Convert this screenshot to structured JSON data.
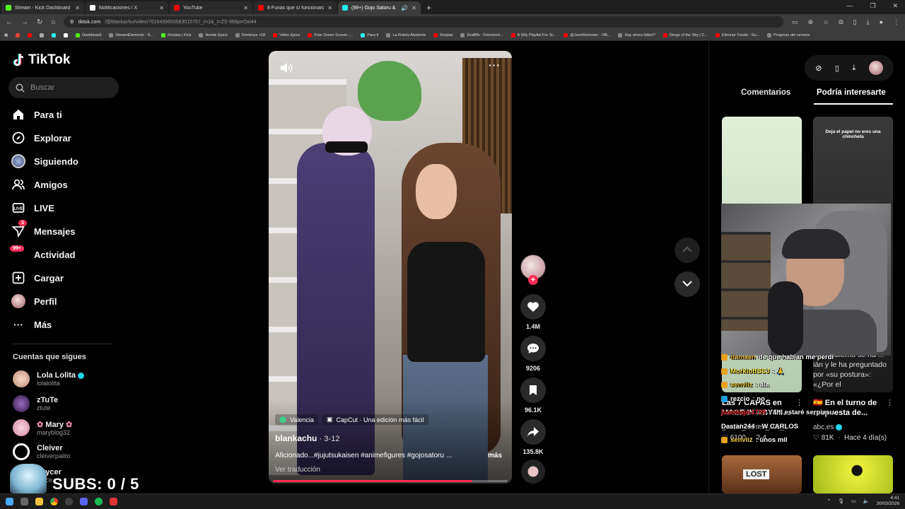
{
  "browser": {
    "tabs": [
      {
        "title": "Stream - Kick Dashboard",
        "color": "#53fc18",
        "active": false
      },
      {
        "title": "Notificaciones / X",
        "color": "#ffffff",
        "active": false
      },
      {
        "title": "YouTube",
        "color": "#ff0000",
        "active": false
      },
      {
        "title": "8 Funas que sí funcionaron y q",
        "color": "#ff0000",
        "active": false
      },
      {
        "title": "(99+) Gojo Satoru & Suku",
        "color": "#25f4ee",
        "active": true
      }
    ],
    "url_host": "tiktok.com",
    "url_path": "/@blankachu/video/7616439653583015757_r=1&_t=ZS-956prrOxI44",
    "bookmarks": [
      "Dashboard",
      "StreamElements - S...",
      "Serpias | Kick",
      "Hentai Epico",
      "Femboys +18",
      "Video Epico",
      "Free Green Screen -...",
      "Para ti",
      "La Ruleta Aleatoria",
      "Serpias",
      "GrafMe - Fotomont...",
      "A Silly Playlist For Si...",
      "@JaneRemover - OB...",
      "Hay ahora fútbol?",
      "Derge of the Sky | C...",
      "Eliminar Fondo - Su...",
      "Progreso del servicio"
    ]
  },
  "sidebar": {
    "logo": "TikTok",
    "search_placeholder": "Buscar",
    "nav": [
      {
        "label": "Para ti",
        "icon": "home-icon",
        "badge": ""
      },
      {
        "label": "Explorar",
        "icon": "compass-icon",
        "badge": ""
      },
      {
        "label": "Siguiendo",
        "icon": "following-avatar-icon",
        "badge": ""
      },
      {
        "label": "Amigos",
        "icon": "friends-icon",
        "badge": ""
      },
      {
        "label": "LIVE",
        "icon": "live-icon",
        "badge": ""
      },
      {
        "label": "Mensajes",
        "icon": "messages-icon",
        "badge": "3"
      },
      {
        "label": "Actividad",
        "icon": "activity-icon",
        "badge": "99+"
      },
      {
        "label": "Cargar",
        "icon": "upload-icon",
        "badge": ""
      },
      {
        "label": "Perfil",
        "icon": "profile-avatar-icon",
        "badge": ""
      },
      {
        "label": "Más",
        "icon": "more-icon",
        "badge": ""
      }
    ],
    "following_title": "Cuentas que sigues",
    "following": [
      {
        "name": "Lola Lolita",
        "handle": "lolalolita",
        "verified": true,
        "color": "#e9b6a4"
      },
      {
        "name": "zTuTe",
        "handle": "ztute",
        "verified": false,
        "color": "#5a2f7a"
      },
      {
        "name": "Mary",
        "handle": "maryblog32",
        "verified": false,
        "color": "#f4c6d6"
      },
      {
        "name": "Cleiver",
        "handle": "cleiverpalito",
        "verified": false,
        "color": "#ffffff"
      },
      {
        "name": "Drycer",
        "handle": "drycer",
        "verified": false,
        "color": "#7fc8d6"
      }
    ],
    "subs_overlay": "SUBS: 0 / 5"
  },
  "video": {
    "location_chip": "Valencia",
    "capcut_chip": "CapCut · Una edición más fácil",
    "author": "blankachu",
    "date": "· 3-12",
    "caption": "Aficionado...#jujutsukaisen #animefigures #gojosatoru ...",
    "more": "más",
    "translate": "Ver traducción",
    "progress": 0.85
  },
  "actions": {
    "likes": "1.4M",
    "comments": "9206",
    "saves": "96.1K",
    "shares": "135.8K"
  },
  "right_panel": {
    "tab_comments": "Comentarios",
    "tab_suggested": "Podría interesarte",
    "card1": {
      "title": "Las 7 CAPAS en MADE IN ABYSS...",
      "author": "gerald_darrell_x0c_1",
      "likes": "6100",
      "date": "2-4"
    },
    "card2": {
      "thumb_text": "Deja el papel no eres una chincheta",
      "overlay_text": "En el Congreso para informar sobre la guerra, el presidente del Gobierno se ha ... ián y le ha preguntado por «su postura»: «¿Por el",
      "title": "🇪🇸 En el turno de respuesta de...",
      "author": "abc.es",
      "likes": "81K",
      "date": "Hace 4 día(s)"
    },
    "card3_text": "LOST"
  },
  "stream_chat": [
    {
      "user": "damaen",
      "msg": "de que hablan me perdí",
      "color": "#f0c040"
    },
    {
      "user": "MorklottSSJ",
      "msg": ": 🙏",
      "color": "#ffee44"
    },
    {
      "user": "senviiz",
      "msg": ": ala",
      "color": "#f0d040"
    },
    {
      "user": "rezcio",
      "msg": ": no",
      "color": "#ffffff"
    },
    {
      "user": "juanitope1729",
      "msg": ": ahi estaré serpias...",
      "color": "#ff3b3b"
    },
    {
      "user": "Dastan244",
      "msg": ": W CARLOS",
      "color": "#ffffff"
    },
    {
      "user": "senviiz",
      "msg": ": unos mil",
      "color": "#f0d040"
    }
  ],
  "taskbar": {
    "time": "4:41",
    "date": "30/03/2026"
  }
}
